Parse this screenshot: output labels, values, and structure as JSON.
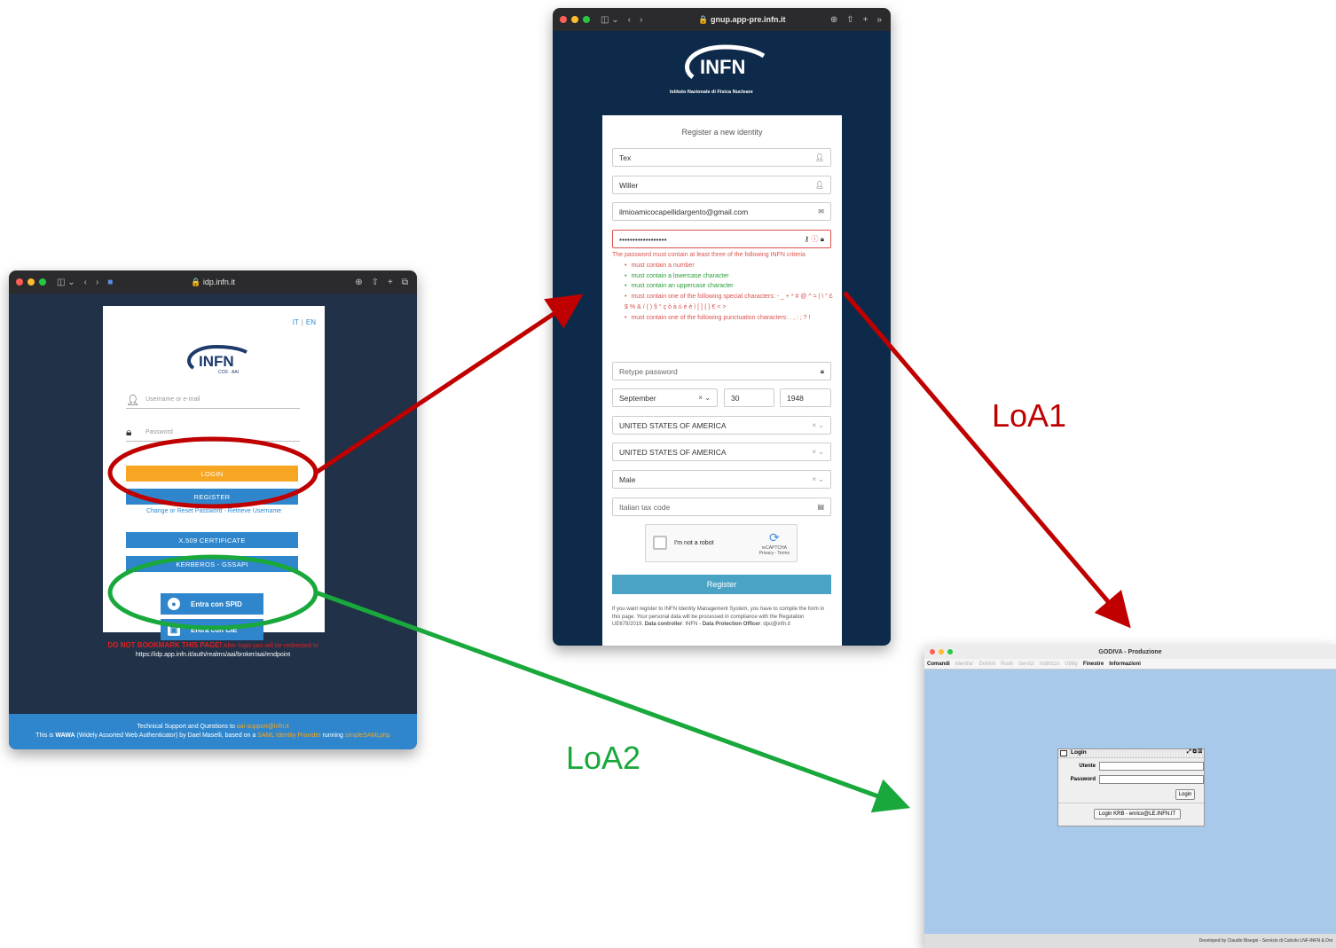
{
  "annotations": {
    "loa1": "LoA1",
    "loa2": "LoA2",
    "colors": {
      "loa1": "#c00000",
      "loa2": "#19a83b"
    }
  },
  "idp_window": {
    "url": "idp.infn.it",
    "lang_it": "IT",
    "lang_en": "EN",
    "logo_text": "INFN",
    "logo_sub": "CCR · AAI",
    "username_placeholder": "Username or e-mail",
    "password_placeholder": "Password",
    "login_label": "LOGIN",
    "register_label": "REGISTER",
    "reset_link": "Change or Reset Password - Retrieve Username",
    "x509_label": "X.509 CERTIFICATE",
    "kerberos_label": "KERBEROS - GSSAPI",
    "spid_label": "Entra con SPID",
    "cie_label": "Entra con CIE",
    "warning_bold": "DO NOT BOOKMARK THIS PAGE!",
    "warning_text": "After login you will be redirected to",
    "redirect_url": "https://idp.app.infn.it/auth/realms/aai/broker/aai/endpoint",
    "footer_line1_a": "Technical Support and Questions to",
    "footer_email": "aai-support@infn.it",
    "footer_line2_a": "This is",
    "footer_wawa": "WAWA",
    "footer_line2_b": "(Widely Assorted Web Authenticator) by Dael Maselli, based on a",
    "footer_saml": "SAML Identity Provider",
    "footer_running": "running",
    "footer_simplesaml": "simpleSAMLphp",
    "colors": {
      "bg": "#203148",
      "button": "#2f86cc",
      "login": "#f6a623"
    }
  },
  "register_window": {
    "url": "gnup.app-pre.infn.it",
    "logo_text": "INFN",
    "logo_sub": "Istituto Nazionale di Fisica Nucleare",
    "title": "Register a new identity",
    "first_name": "Tex",
    "last_name": "Willer",
    "email": "ilmioamicocapellidargento@gmail.com",
    "password_masked": "••••••••••••••••••",
    "error_intro": "The password must contain at least three of the following INFN criteria",
    "criteria": [
      {
        "text": "must contain a number",
        "ok": false
      },
      {
        "text": "must contain a lowercase character",
        "ok": true
      },
      {
        "text": "must contain an uppercase character",
        "ok": true
      },
      {
        "text": "must contain one of the following special characters: - _ + * # @ ^ = | \\ \" £ $ % & / ( ) § ° ç ò à ù é è ì [ ] { } € < >",
        "ok": false
      },
      {
        "text": "must contain one of the following punctuation characters: . , : ; ? !",
        "ok": false
      }
    ],
    "retype_placeholder": "Retype password",
    "birth_month": "September",
    "birth_day": "30",
    "birth_year": "1948",
    "country1": "UNITED STATES OF AMERICA",
    "country2": "UNITED STATES OF AMERICA",
    "gender": "Male",
    "tax_placeholder": "Italian tax code",
    "captcha_label": "I'm not a robot",
    "captcha_brand": "reCAPTCHA",
    "captcha_links": "Privacy - Terms",
    "register_button": "Register",
    "fine_print_a": "If you want register to INFN Identity Management System, you have to compile the form in this page. Your personal data will be processed in compliance with the Regulation UE679/2019.",
    "fine_controller_label": "Data controller",
    "fine_controller": ": INFN -",
    "fine_dpo_label": "Data Protection Officer",
    "fine_dpo": ": dpo@infn.it",
    "colors": {
      "bg": "#0e2a4a",
      "error": "#d9534f",
      "ok": "#2a9d3b",
      "button": "#4aa3c4"
    }
  },
  "godiva_window": {
    "title": "GODIVA - Produzione",
    "menu": [
      {
        "label": "Comandi",
        "enabled": true
      },
      {
        "label": "Identita'",
        "enabled": false
      },
      {
        "label": "Domini",
        "enabled": false
      },
      {
        "label": "Ruoli",
        "enabled": false
      },
      {
        "label": "Servizi",
        "enabled": false
      },
      {
        "label": "Indirizzo",
        "enabled": false
      },
      {
        "label": "Utility",
        "enabled": false
      },
      {
        "label": "Finestre",
        "enabled": true
      },
      {
        "label": "Informazioni",
        "enabled": true
      }
    ],
    "dialog_title": "Login",
    "user_label": "Utente",
    "password_label": "Password",
    "login_button": "Login",
    "krb_button": "Login KRB - enrico@LE.INFN.IT",
    "status": "Developed by Claudio Bisegni - Servizio di Calcolo LNF-INFN & Dot",
    "colors": {
      "bg": "#a8c9ea"
    }
  }
}
